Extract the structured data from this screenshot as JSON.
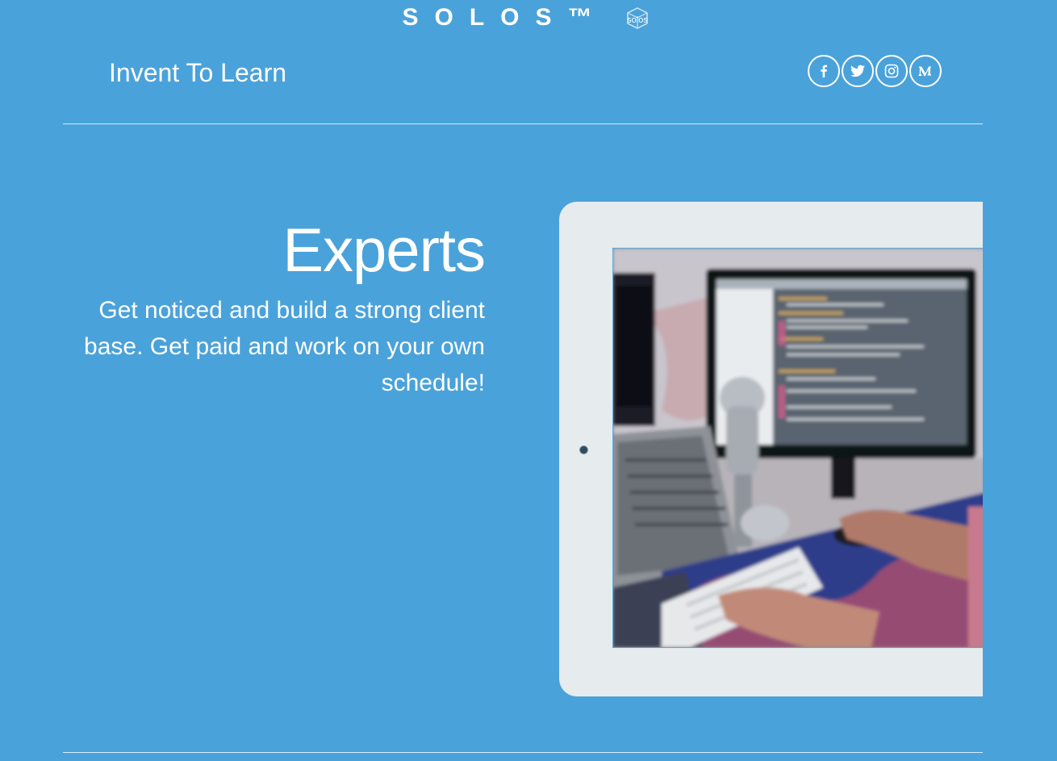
{
  "brand": {
    "name": "SOLOS™",
    "logo_text": "solos",
    "logo_icon": "solos-cube-logo"
  },
  "header": {
    "title": "Invent To Learn"
  },
  "social": [
    {
      "name": "facebook",
      "icon": "facebook-icon"
    },
    {
      "name": "twitter",
      "icon": "twitter-icon"
    },
    {
      "name": "instagram",
      "icon": "instagram-icon"
    },
    {
      "name": "medium",
      "icon": "medium-icon"
    }
  ],
  "hero": {
    "title": "Experts",
    "body": "Get noticed and build a strong client base. Get paid and work on your own schedule!"
  },
  "colors": {
    "background": "#4aa2da",
    "text": "#ffffff",
    "tablet_frame": "#e6ebee"
  }
}
